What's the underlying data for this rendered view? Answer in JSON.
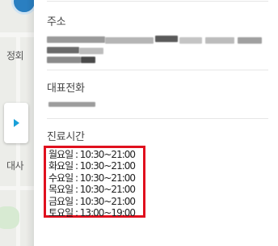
{
  "map": {
    "labels": [
      "정회",
      "대사"
    ]
  },
  "side_toggle": {
    "icon": "chevron-right-icon"
  },
  "address": {
    "title": "주소"
  },
  "phone": {
    "title": "대표전화"
  },
  "hours": {
    "title": "진료시간",
    "rows": [
      {
        "day": "월요일",
        "time": "10:30~21:00"
      },
      {
        "day": "화요일",
        "time": "10:30~21:00"
      },
      {
        "day": "수요일",
        "time": "10:30~21:00"
      },
      {
        "day": "목요일",
        "time": "10:30~21:00"
      },
      {
        "day": "금요일",
        "time": "10:30~21:00"
      },
      {
        "day": "토요일",
        "time": "13:00~19:00"
      }
    ],
    "highlight_color": "#e0101e"
  }
}
